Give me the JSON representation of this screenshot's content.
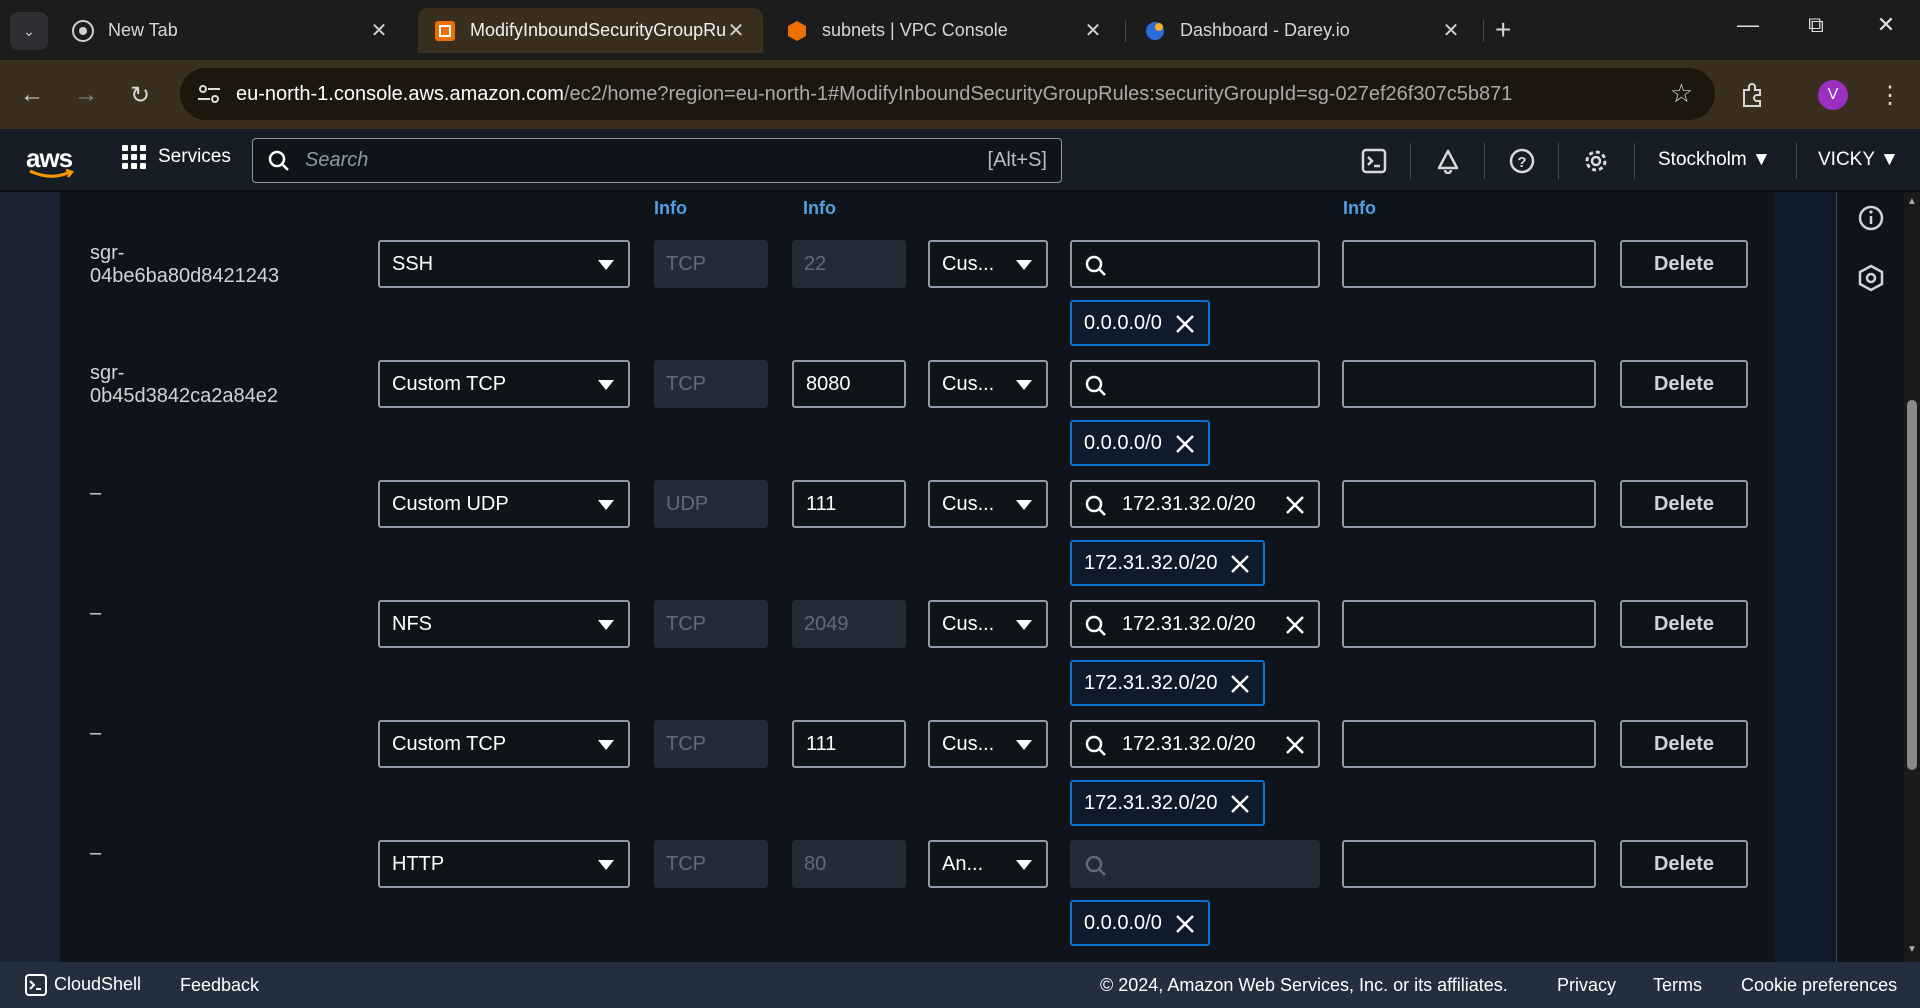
{
  "browser": {
    "tabs": [
      {
        "title": "New Tab",
        "active": false
      },
      {
        "title": "ModifyInboundSecurityGroupRules",
        "active": true
      },
      {
        "title": "subnets | VPC Console",
        "active": false
      },
      {
        "title": "Dashboard - Darey.io",
        "active": false
      }
    ],
    "url_host": "eu-north-1.console.aws.amazon.com",
    "url_path": "/ec2/home?region=eu-north-1#ModifyInboundSecurityGroupRules:securityGroupId=sg-027ef26f307c5b871",
    "avatar_letter": "V"
  },
  "aws_header": {
    "logo": "aws",
    "services_label": "Services",
    "search_placeholder": "Search",
    "search_shortcut": "[Alt+S]",
    "region": "Stockholm",
    "user": "VICKY"
  },
  "table": {
    "info_labels": [
      "Info",
      "Info",
      "Info"
    ],
    "rows": [
      {
        "id": "sgr-04be6ba80d8421243",
        "type": "SSH",
        "protocol": "TCP",
        "port": "22",
        "port_editable": false,
        "source_type": "Cus...",
        "search_value": "",
        "search_disabled": false,
        "token": "0.0.0.0/0",
        "description": "",
        "delete": "Delete"
      },
      {
        "id": "sgr-0b45d3842ca2a84e2",
        "type": "Custom TCP",
        "protocol": "TCP",
        "port": "8080",
        "port_editable": true,
        "source_type": "Cus...",
        "search_value": "",
        "search_disabled": false,
        "token": "0.0.0.0/0",
        "description": "",
        "delete": "Delete"
      },
      {
        "id": "–",
        "type": "Custom UDP",
        "protocol": "UDP",
        "port": "111",
        "port_editable": true,
        "source_type": "Cus...",
        "search_value": "172.31.32.0/20",
        "search_disabled": false,
        "token": "172.31.32.0/20",
        "description": "",
        "delete": "Delete"
      },
      {
        "id": "–",
        "type": "NFS",
        "protocol": "TCP",
        "port": "2049",
        "port_editable": false,
        "source_type": "Cus...",
        "search_value": "172.31.32.0/20",
        "search_disabled": false,
        "token": "172.31.32.0/20",
        "description": "",
        "delete": "Delete"
      },
      {
        "id": "–",
        "type": "Custom TCP",
        "protocol": "TCP",
        "port": "111",
        "port_editable": true,
        "source_type": "Cus...",
        "search_value": "172.31.32.0/20",
        "search_disabled": false,
        "token": "172.31.32.0/20",
        "description": "",
        "delete": "Delete"
      },
      {
        "id": "–",
        "type": "HTTP",
        "protocol": "TCP",
        "port": "80",
        "port_editable": false,
        "source_type": "An...",
        "search_value": "",
        "search_disabled": true,
        "token": "0.0.0.0/0",
        "description": "",
        "delete": "Delete"
      }
    ]
  },
  "footer": {
    "cloudshell": "CloudShell",
    "feedback": "Feedback",
    "copyright": "© 2024, Amazon Web Services, Inc. or its affiliates.",
    "privacy": "Privacy",
    "terms": "Terms",
    "cookies": "Cookie preferences"
  },
  "colors": {
    "browser_frame": "#3a2e1e",
    "aws_header": "#161d26",
    "panel": "#0f141a",
    "link": "#539fe5",
    "token_border": "#0972d3"
  }
}
